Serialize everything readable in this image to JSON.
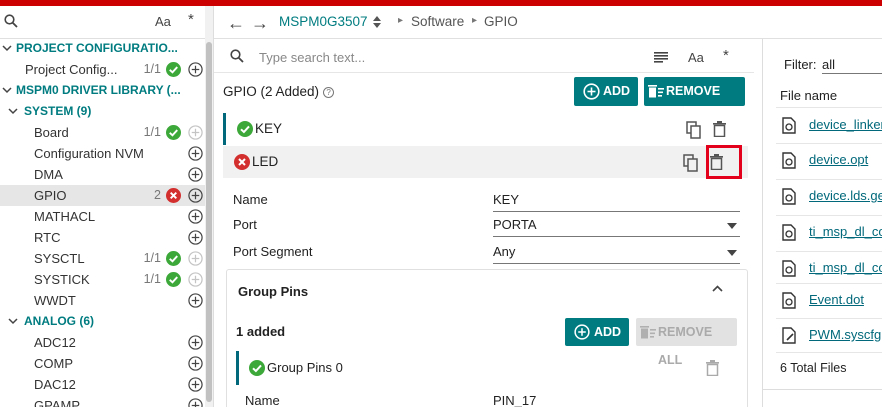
{
  "colors": {
    "teal": "#007c80",
    "green": "#3da83a",
    "red": "#d32f2f",
    "highlight": "#e3001b",
    "top_bar": "#cc0000"
  },
  "left": {
    "aa_label": "Aa",
    "star_label": "*",
    "items": [
      {
        "label": "PROJECT CONFIGURATIO...",
        "kind": "header",
        "expanded": true
      },
      {
        "label": "Project Config...",
        "count": "1/1",
        "status": "ok",
        "add": true
      },
      {
        "label": "MSPM0 DRIVER LIBRARY (...",
        "kind": "header",
        "expanded": true
      },
      {
        "label": "SYSTEM (9)",
        "kind": "header",
        "expanded": true
      },
      {
        "label": "Board",
        "count": "1/1",
        "status": "ok",
        "add": true,
        "add_disabled": true
      },
      {
        "label": "Configuration NVM",
        "count": "",
        "add": true
      },
      {
        "label": "DMA",
        "count": "",
        "add": true
      },
      {
        "label": "GPIO",
        "count": "2",
        "status": "error",
        "add": true,
        "selected": true
      },
      {
        "label": "MATHACL",
        "count": "",
        "add": true
      },
      {
        "label": "RTC",
        "count": "",
        "add": true
      },
      {
        "label": "SYSCTL",
        "count": "1/1",
        "status": "ok",
        "add": true,
        "add_disabled": true
      },
      {
        "label": "SYSTICK",
        "count": "1/1",
        "status": "ok",
        "add": true,
        "add_disabled": true
      },
      {
        "label": "WWDT",
        "count": "",
        "add": true
      },
      {
        "label": "ANALOG (6)",
        "kind": "header",
        "expanded": true
      },
      {
        "label": "ADC12",
        "count": "",
        "add": true
      },
      {
        "label": "COMP",
        "count": "",
        "add": true
      },
      {
        "label": "DAC12",
        "count": "",
        "add": true
      },
      {
        "label": "GPAMP",
        "count": "",
        "add": true
      }
    ]
  },
  "breadcrumb": {
    "device": "MSPM0G3507",
    "items": [
      "Software",
      "GPIO"
    ]
  },
  "main": {
    "search_placeholder": "Type search text...",
    "aa_label": "Aa",
    "star_label": "*",
    "title": "GPIO (2 Added)",
    "help_glyph": "?",
    "add_label": "ADD",
    "remove_all_label": "REMOVE ALL",
    "instances": [
      {
        "name": "KEY",
        "status": "ok"
      },
      {
        "name": "LED",
        "status": "error"
      }
    ],
    "props": [
      {
        "label": "Name",
        "value": "KEY",
        "dropdown": false
      },
      {
        "label": "Port",
        "value": "PORTA",
        "dropdown": true
      },
      {
        "label": "Port Segment",
        "value": "Any",
        "dropdown": true
      }
    ],
    "group": {
      "title": "Group Pins",
      "added": "1 added",
      "add_label": "ADD",
      "remove_all_label": "REMOVE ALL",
      "pin_name": "Group Pins 0",
      "sub_label": "Name",
      "sub_value": "PIN_17"
    }
  },
  "files": {
    "filter_label": "Filter:",
    "filter_value": "all",
    "header": "File name",
    "items": [
      "device_linker",
      "device.opt",
      "device.lds.ge",
      "ti_msp_dl_co",
      "ti_msp_dl_co",
      "Event.dot",
      "PWM.syscfg"
    ],
    "total": "6 Total Files"
  }
}
